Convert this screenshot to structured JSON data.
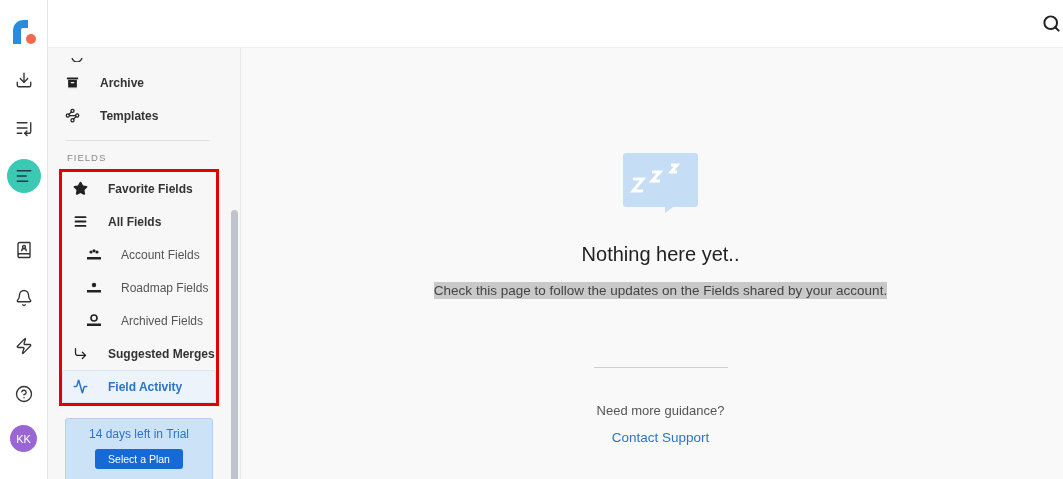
{
  "rail": {
    "avatar": "KK",
    "items": [
      {
        "selected": false
      },
      {
        "selected": false
      },
      {
        "selected": true
      },
      {
        "selected": false
      },
      {
        "selected": false
      },
      {
        "selected": false
      },
      {
        "selected": false
      }
    ]
  },
  "sidebar": {
    "top_items": [
      {
        "label": "Archive"
      },
      {
        "label": "Templates"
      }
    ],
    "section_title": "FIELDS",
    "items": [
      {
        "label": "Favorite Fields",
        "selected": false
      },
      {
        "label": "All Fields",
        "selected": false,
        "children": [
          {
            "label": "Account Fields",
            "selected": false
          },
          {
            "label": "Roadmap Fields",
            "selected": false
          },
          {
            "label": "Archived Fields",
            "selected": false
          }
        ]
      },
      {
        "label": "Suggested Merges",
        "selected": false
      },
      {
        "label": "Field Activity",
        "selected": true
      }
    ],
    "trial": {
      "text": "14 days left in Trial",
      "button": "Select a Plan"
    }
  },
  "empty_state": {
    "title": "Nothing here yet..",
    "description": "Check this page to follow the updates on the Fields shared by your account.",
    "description_selected": true,
    "help_text": "Need more guidance?",
    "link": "Contact Support"
  }
}
